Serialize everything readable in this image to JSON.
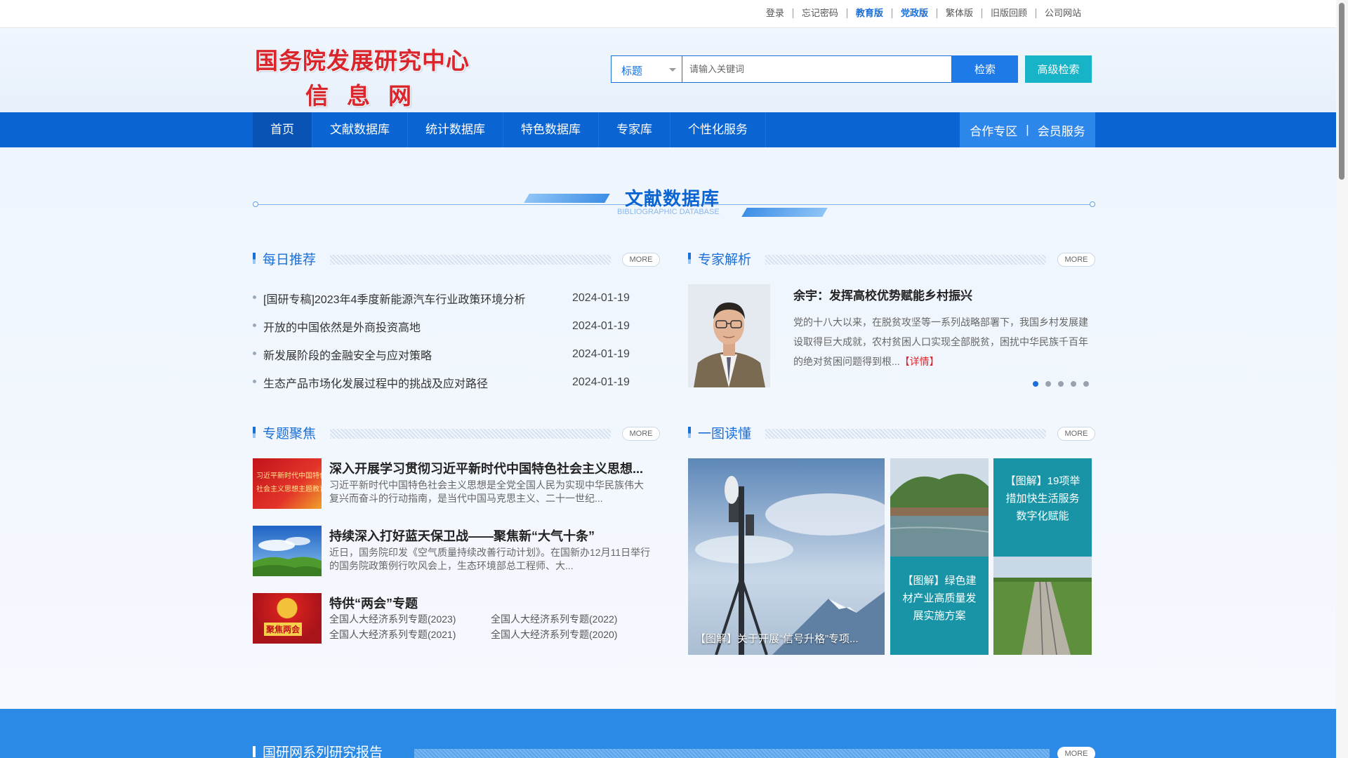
{
  "topbar": {
    "links": [
      {
        "label": "登录",
        "highlight": false
      },
      {
        "label": "忘记密码",
        "highlight": false
      },
      {
        "label": "教育版",
        "highlight": true
      },
      {
        "label": "党政版",
        "highlight": true
      },
      {
        "label": "繁体版",
        "highlight": false
      },
      {
        "label": "旧版回顾",
        "highlight": false
      },
      {
        "label": "公司网站",
        "highlight": false
      }
    ]
  },
  "logo": {
    "line1": "国务院发展研究中心",
    "line2": "信息网"
  },
  "search": {
    "field_value": "标题",
    "placeholder": "请输入关键词",
    "search_label": "检索",
    "advanced_label": "高级检索"
  },
  "nav": {
    "items": [
      "首页",
      "文献数据库",
      "统计数据库",
      "特色数据库",
      "专家库",
      "个性化服务"
    ],
    "active": "首页",
    "right_items": [
      "合作专区",
      "会员服务"
    ],
    "right_sep": "|"
  },
  "section": {
    "title_cn": "文献数据库",
    "title_en": "BIBLIOGRAPHIC DATABASE"
  },
  "more_label": "MORE",
  "daily": {
    "title": "每日推荐",
    "items": [
      {
        "title": "[国研专稿]2023年4季度新能源汽车行业政策环境分析",
        "date": "2024-01-19"
      },
      {
        "title": "开放的中国依然是外商投资高地",
        "date": "2024-01-19"
      },
      {
        "title": "新发展阶段的金融安全与应对策略",
        "date": "2024-01-19"
      },
      {
        "title": "生态产品市场化发展过程中的挑战及应对路径",
        "date": "2024-01-19"
      }
    ]
  },
  "expert": {
    "title": "专家解析",
    "headline": "余宇：发挥高校优势赋能乡村振兴",
    "body": "党的十八大以来，在脱贫攻坚等一系列战略部署下，我国乡村发展建设取得巨大成就，农村贫困人口实现全部脱贫，困扰中华民族千百年的绝对贫困问题得到根...",
    "detail_label": "【详情】",
    "pager_count": 5,
    "pager_active": 1
  },
  "topics": {
    "title": "专题聚焦",
    "items": [
      {
        "title": "深入开展学习贯彻习近平新时代中国特色社会主义思想...",
        "desc": "习近平新时代中国特色社会主义思想是全党全国人民为实现中华民族伟大复兴而奋斗的行动指南，是当代中国马克思主义、二十一世纪...",
        "thumb_text_1": "习近平新时代中国特色",
        "thumb_text_2": "社会主义思想主题教育"
      },
      {
        "title": "持续深入打好蓝天保卫战——聚焦新“大气十条”",
        "desc": "近日，国务院印发《空气质量持续改善行动计划》。在国新办12月11日举行的国务院政策例行吹风会上，生态环境部总工程师、大..."
      },
      {
        "title": "特供“两会”专题",
        "thumb_text": "聚焦两会",
        "links": [
          "全国人大经济系列专题(2023)",
          "全国人大经济系列专题(2022)",
          "全国人大经济系列专题(2021)",
          "全国人大经济系列专题(2020)"
        ]
      }
    ]
  },
  "graphics": {
    "title": "一图读懂",
    "items": [
      "【图解】关于开展“信号升格”专项...",
      "【图解】绿色建材产业高质量发展实施方案",
      "【图解】19项举措加快生活服务数字化赋能"
    ]
  },
  "bottom": {
    "title": "国研网系列研究报告"
  },
  "colors": {
    "brand_blue": "#0a64d2",
    "logo_red": "#d9252b",
    "teal": "#17b3c6"
  }
}
